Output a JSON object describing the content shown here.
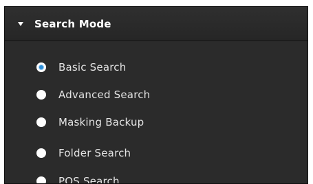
{
  "panel": {
    "title": "Search Mode",
    "collapse_icon": "triangle-down-icon",
    "accent_color": "#2b8ed8",
    "background_color": "#2b2b2b"
  },
  "search_modes": [
    {
      "label": "Basic Search",
      "selected": true
    },
    {
      "label": "Advanced Search",
      "selected": false
    },
    {
      "label": "Masking Backup",
      "selected": false
    },
    {
      "label": "Folder Search",
      "selected": false
    },
    {
      "label": "POS Search",
      "selected": false
    }
  ]
}
